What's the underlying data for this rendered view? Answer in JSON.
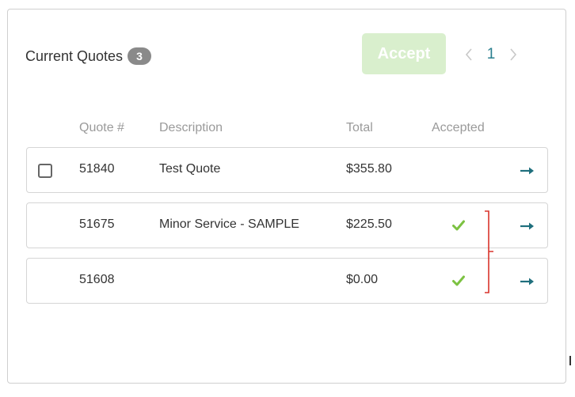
{
  "header": {
    "title": "Current Quotes",
    "count": "3",
    "accept_label": "Accept",
    "page": "1"
  },
  "columns": [
    "Quote #",
    "Description",
    "Total",
    "Accepted"
  ],
  "rows": [
    {
      "quote": "51840",
      "description": "Test Quote",
      "total": "$355.80",
      "accepted": false,
      "has_checkbox": true
    },
    {
      "quote": "51675",
      "description": "Minor Service - SAMPLE",
      "total": "$225.50",
      "accepted": true,
      "has_checkbox": false
    },
    {
      "quote": "51608",
      "description": "",
      "total": "$0.00",
      "accepted": true,
      "has_checkbox": false
    }
  ],
  "icons": {
    "prev": "chevron-left-icon",
    "next": "chevron-right-icon",
    "accepted": "check-icon",
    "open": "arrow-right-icon"
  },
  "colors": {
    "accent": "#2a7f8f",
    "accept_button": "#d9efcd",
    "check": "#7cc242",
    "bracket": "#d9342b"
  }
}
